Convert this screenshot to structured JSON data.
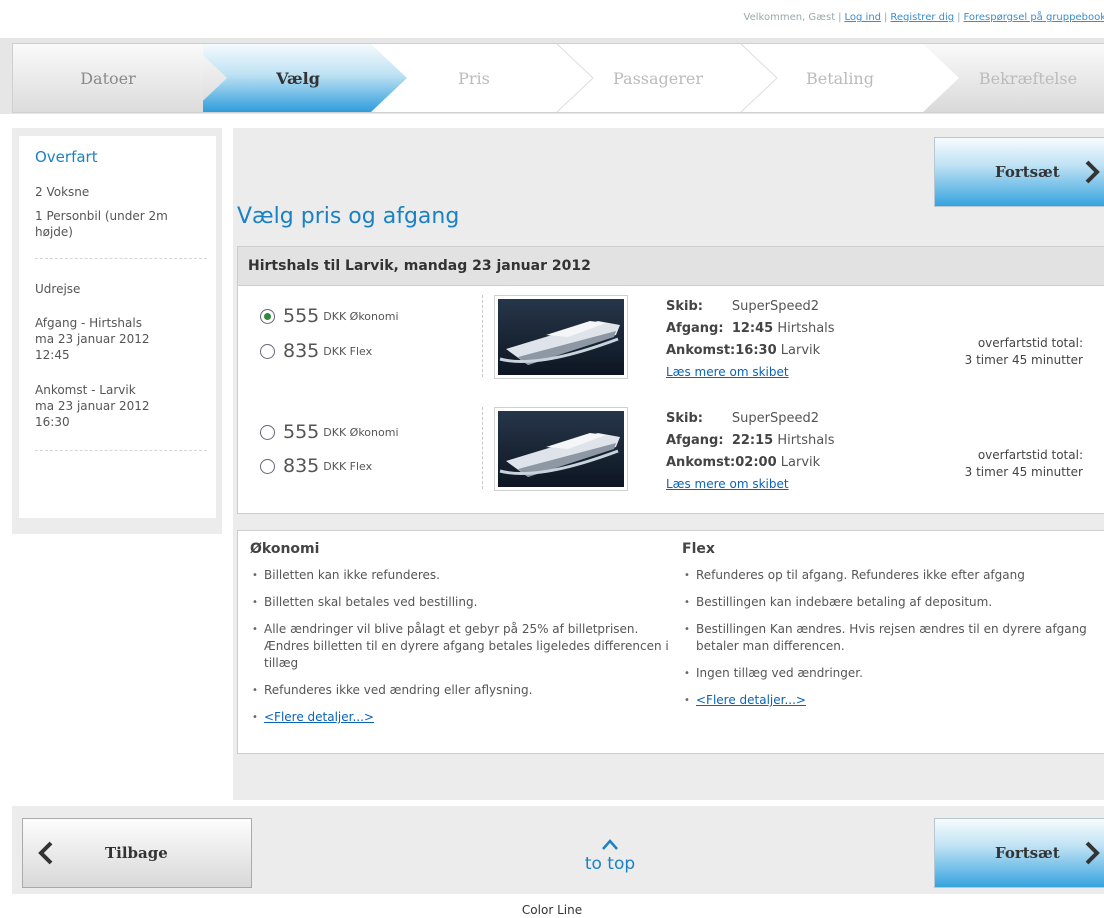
{
  "topbar": {
    "welcome": "Velkommen, Gæst",
    "login": "Log ind",
    "register": "Registrer dig",
    "group": "Forespørgsel på gruppebook"
  },
  "steps": [
    "Datoer",
    "Vælg",
    "Pris",
    "Passagerer",
    "Betaling",
    "Bekræftelse"
  ],
  "sidebar": {
    "title": "Overfart",
    "adults": "2 Voksne",
    "car": "1 Personbil (under 2m højde)",
    "departure_label": "Udrejse",
    "depart_line1": "Afgang - Hirtshals",
    "depart_line2": "ma 23 januar 2012",
    "depart_time": "12:45",
    "arrive_line1": "Ankomst - Larvik",
    "arrive_line2": "ma 23 januar 2012",
    "arrive_time": "16:30"
  },
  "main": {
    "continue_label": "Fortsæt",
    "heading": "Vælg pris og afgang",
    "route_header": "Hirtshals til Larvik, mandag 23 januar 2012",
    "departures": [
      {
        "options": [
          {
            "price": "555",
            "fare": "DKK Økonomi",
            "selected": true
          },
          {
            "price": "835",
            "fare": "DKK Flex",
            "selected": false
          }
        ],
        "ship_label": "Skib:",
        "ship": "SuperSpeed2",
        "dep_label": "Afgang:",
        "dep_time": "12:45",
        "dep_port": "Hirtshals",
        "arr_label": "Ankomst:",
        "arr_time": "16:30",
        "arr_port": "Larvik",
        "more": "Læs mere om skibet",
        "dur_label": "overfartstid total:",
        "dur": "3 timer 45 minutter"
      },
      {
        "options": [
          {
            "price": "555",
            "fare": "DKK Økonomi",
            "selected": false
          },
          {
            "price": "835",
            "fare": "DKK Flex",
            "selected": false
          }
        ],
        "ship_label": "Skib:",
        "ship": "SuperSpeed2",
        "dep_label": "Afgang:",
        "dep_time": "22:15",
        "dep_port": "Hirtshals",
        "arr_label": "Ankomst:",
        "arr_time": "02:00",
        "arr_port": "Larvik",
        "more": "Læs mere om skibet",
        "dur_label": "overfartstid total:",
        "dur": "3 timer 45 minutter"
      }
    ]
  },
  "info": {
    "economy": {
      "title": "Økonomi",
      "items": [
        "Billetten kan ikke refunderes.",
        "Billetten skal betales ved bestilling.",
        "Alle ændringer vil blive pålagt et gebyr på 25% af billetprisen. Ændres billetten til en dyrere afgang betales ligeledes differencen i tillæg",
        "Refunderes ikke ved ændring eller aflysning."
      ],
      "more": "<Flere detaljer...>"
    },
    "flex": {
      "title": "Flex",
      "items": [
        "Refunderes op til afgang. Refunderes ikke efter afgang",
        "Bestillingen kan indebære betaling af depositum.",
        "Bestillingen Kan ændres. Hvis rejsen ændres til en dyrere afgang betaler man differencen.",
        "Ingen tillæg ved ændringer."
      ],
      "more": "<Flere detaljer...>"
    }
  },
  "bottom": {
    "back": "Tilbage",
    "continue": "Fortsæt",
    "totop": "to top"
  },
  "footer": "Color Line",
  "colors": {
    "accent": "#1a82c4",
    "active_step": "#3aa4de",
    "link": "#0a63b8"
  }
}
